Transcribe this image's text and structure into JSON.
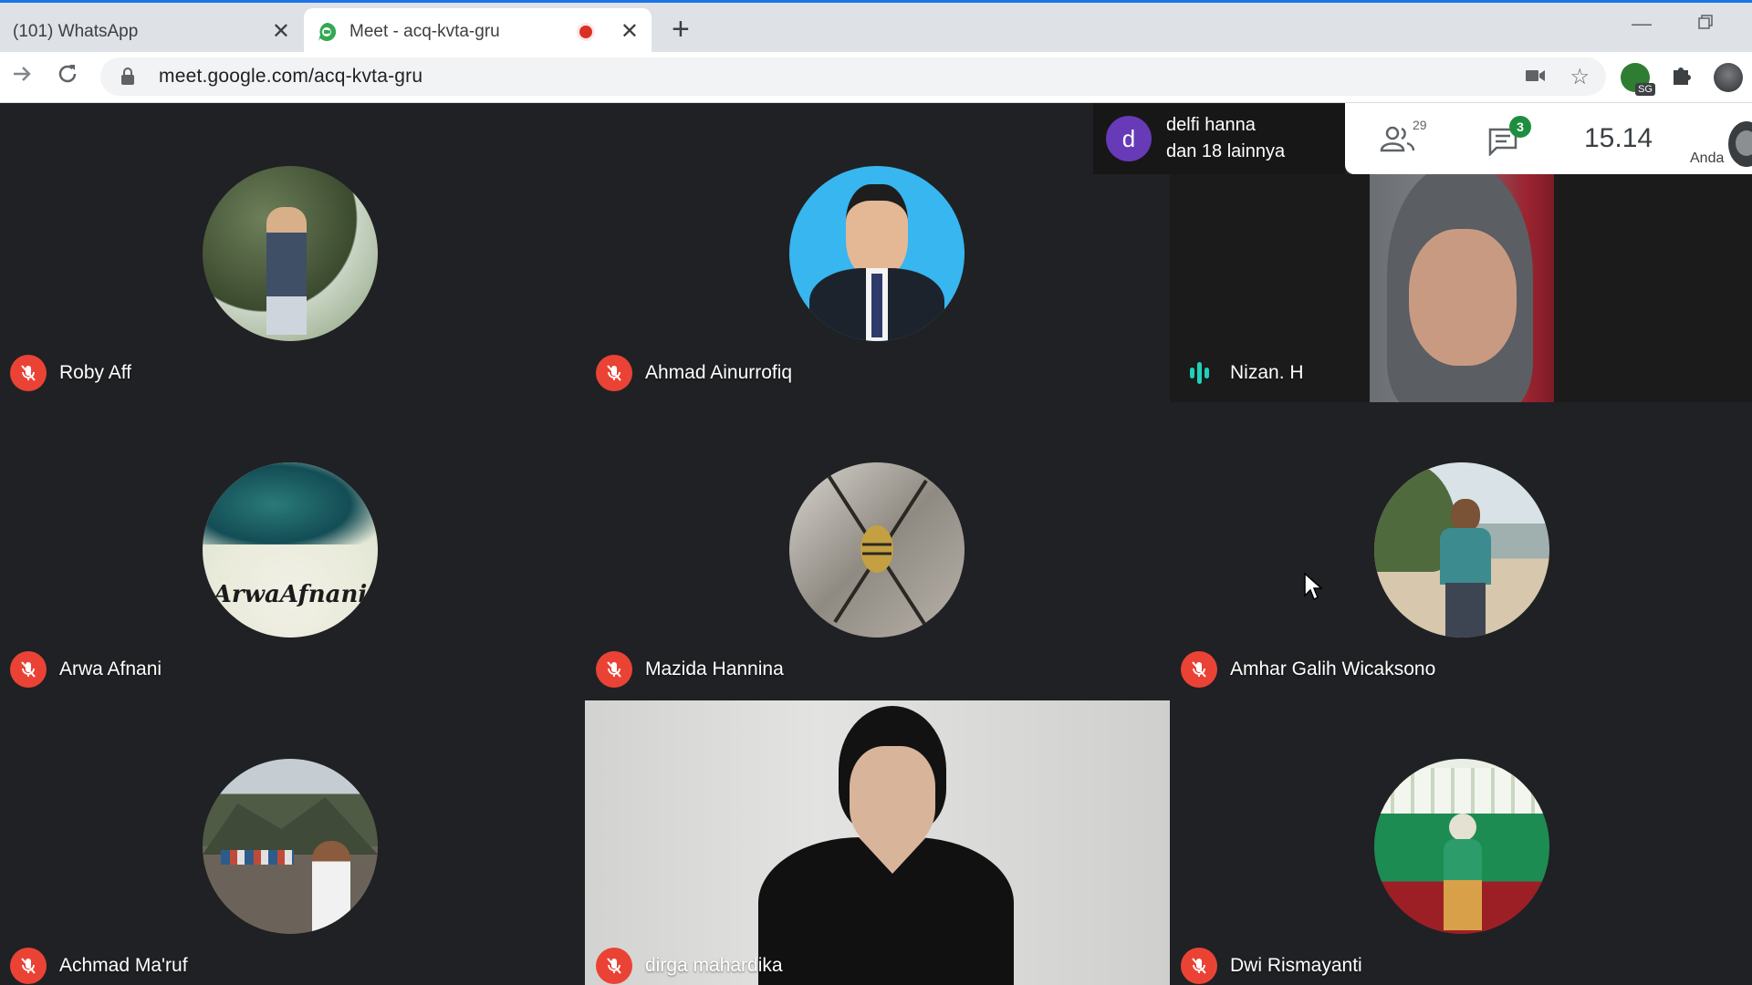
{
  "browser": {
    "tabs": [
      {
        "title": "(101) WhatsApp",
        "active": false
      },
      {
        "title": "Meet - acq-kvta-gru",
        "active": true,
        "recording": true
      }
    ],
    "url": "meet.google.com/acq-kvta-gru",
    "extension_badge": "SG"
  },
  "meet": {
    "presenter": {
      "initial": "d",
      "line1": "delfi hanna",
      "line2": "dan 18 lainnya"
    },
    "participants_count": "29",
    "chat_badge": "3",
    "clock": "15.14",
    "self_label": "Anda"
  },
  "participants": [
    {
      "name": "Roby Aff",
      "muted": true
    },
    {
      "name": "Ahmad Ainurrofiq",
      "muted": true
    },
    {
      "name": "Nizan. H",
      "muted": false,
      "speaking": true
    },
    {
      "name": "Arwa Afnani",
      "muted": true,
      "avatar_text": "ArwaAfnani"
    },
    {
      "name": "Mazida Hannina",
      "muted": true
    },
    {
      "name": "Amhar Galih Wicaksono",
      "muted": true
    },
    {
      "name": "Achmad Ma'ruf",
      "muted": true
    },
    {
      "name": "dirga mahardika",
      "muted": true
    },
    {
      "name": "Dwi Rismayanti",
      "muted": true
    }
  ],
  "colors": {
    "accent": "#1a73e8",
    "mic_off": "#ea4335",
    "speaking": "#1ed1b9",
    "background": "#202124"
  }
}
